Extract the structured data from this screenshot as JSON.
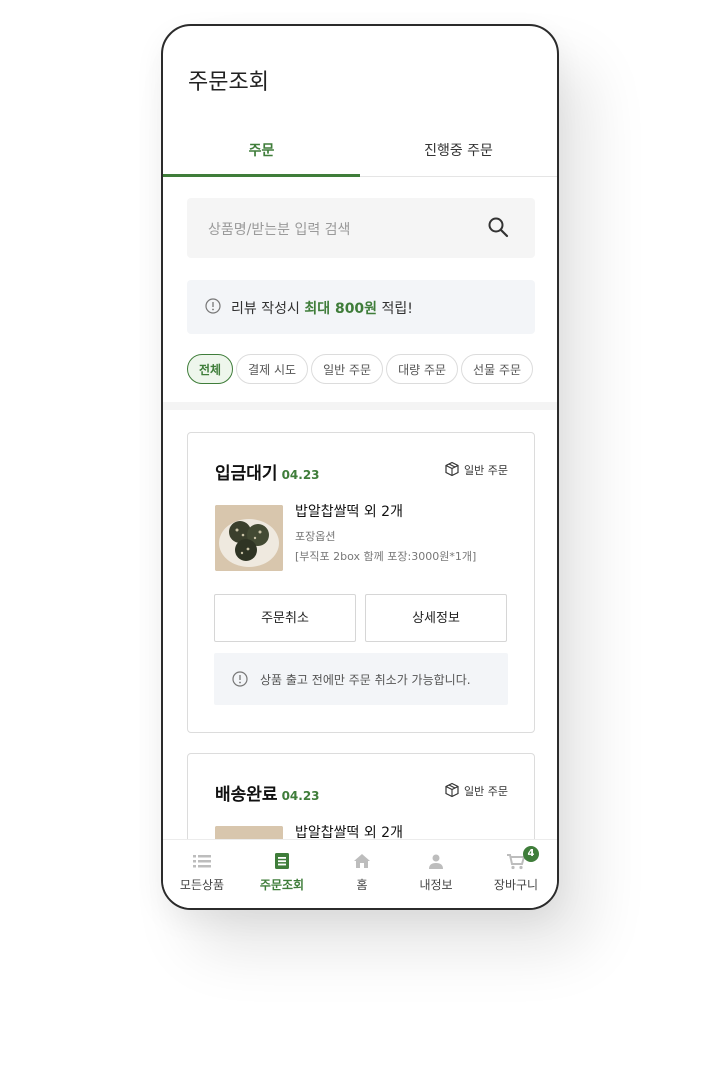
{
  "header": {
    "title": "주문조회"
  },
  "tabs": [
    {
      "label": "주문"
    },
    {
      "label": "진행중 주문"
    }
  ],
  "search": {
    "placeholder": "상품명/받는분 입력 검색"
  },
  "notice": {
    "prefix": "리뷰 작성시 ",
    "highlight": "최대 800원",
    "suffix": " 적립!"
  },
  "filters": [
    "전체",
    "결제 시도",
    "일반 주문",
    "대량 주문",
    "선물 주문"
  ],
  "orders": [
    {
      "status": "입금대기",
      "date": "04.23",
      "order_type": "일반 주문",
      "product_name": "밥알찹쌀떡 외 2개",
      "option_label": "포장옵션",
      "option_detail": "[부직포 2box 함께 포장:3000원*1개]",
      "buttons": [
        "주문취소",
        "상세정보"
      ],
      "cancel_notice": "상품 출고 전에만 주문 취소가 가능합니다."
    },
    {
      "status": "배송완료",
      "date": "04.23",
      "order_type": "일반 주문",
      "product_name": "밥알찹쌀떡 외 2개"
    }
  ],
  "bottom_nav": [
    {
      "label": "모든상품",
      "icon": "list-icon"
    },
    {
      "label": "주문조회",
      "icon": "order-icon"
    },
    {
      "label": "홈",
      "icon": "home-icon"
    },
    {
      "label": "내정보",
      "icon": "user-icon"
    },
    {
      "label": "장바구니",
      "icon": "cart-icon",
      "badge": "4"
    }
  ],
  "colors": {
    "accent": "#3f7d3a"
  }
}
